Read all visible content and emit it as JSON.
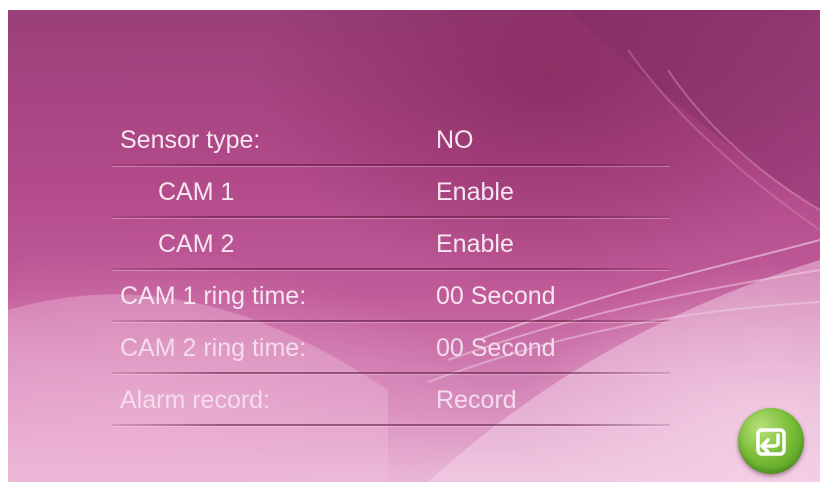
{
  "settings": {
    "rows": [
      {
        "label": "Sensor type:",
        "value": "NO"
      },
      {
        "label": "CAM 1",
        "value": "Enable"
      },
      {
        "label": "CAM 2",
        "value": "Enable"
      },
      {
        "label": "CAM 1 ring time:",
        "value": "00 Second"
      },
      {
        "label": "CAM 2 ring time:",
        "value": "00 Second"
      },
      {
        "label": "Alarm record:",
        "value": "Record"
      }
    ]
  },
  "back_button": {
    "icon": "back-arrow-icon"
  },
  "colors": {
    "background": "#b24a8a",
    "text": "#f6e6ef",
    "button": "#7cbf3a"
  }
}
